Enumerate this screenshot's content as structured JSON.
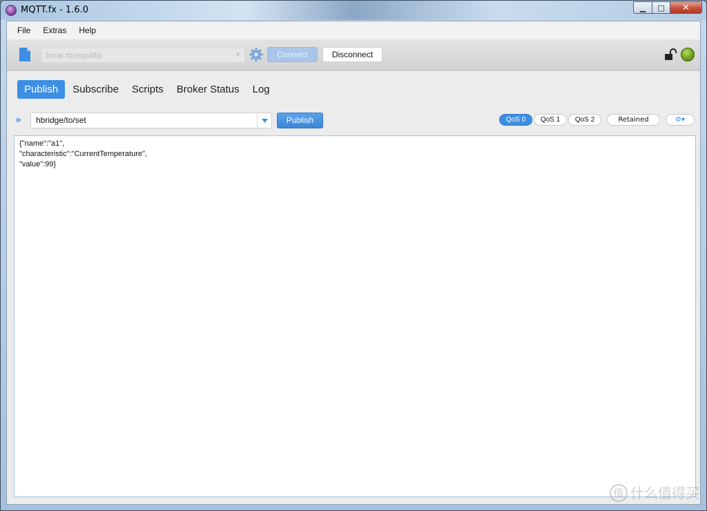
{
  "window": {
    "title": "MQTT.fx - 1.6.0",
    "minimize_label": "▁",
    "maximize_label": "□",
    "close_label": "✕"
  },
  "menu": {
    "items": [
      {
        "label": "File"
      },
      {
        "label": "Extras"
      },
      {
        "label": "Help"
      }
    ]
  },
  "toolbar": {
    "profile": "local mosquitto",
    "connect_label": "Connect",
    "disconnect_label": "Disconnect",
    "connection_status": "connected",
    "status_color": "#6d9e1c"
  },
  "tabs": [
    {
      "label": "Publish",
      "active": true
    },
    {
      "label": "Subscribe",
      "active": false
    },
    {
      "label": "Scripts",
      "active": false
    },
    {
      "label": "Broker Status",
      "active": false
    },
    {
      "label": "Log",
      "active": false
    }
  ],
  "publish": {
    "topic": "hbridge/to/set",
    "publish_label": "Publish",
    "qos": [
      {
        "label": "QoS 0",
        "selected": true
      },
      {
        "label": "QoS 1",
        "selected": false
      },
      {
        "label": "QoS 2",
        "selected": false
      }
    ],
    "retained_label": "Retained",
    "payload": "{\"name\":\"a1\",\n\"characteristic\":\"CurrentTemperature\",\n\"value\":99}"
  },
  "watermark": {
    "symbol": "值",
    "text": "什么值得买"
  },
  "accent_color": "#3c8fe3"
}
